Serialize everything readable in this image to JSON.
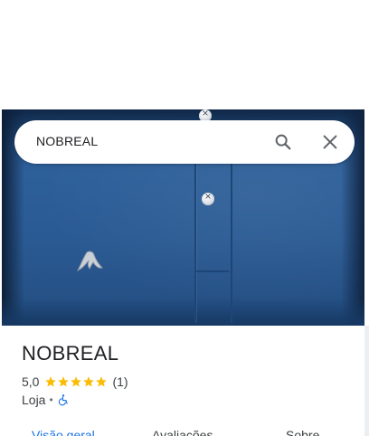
{
  "search": {
    "query": "NOBREAL"
  },
  "place": {
    "name": "NOBREAL",
    "rating": "5,0",
    "stars": 5,
    "review_count": "(1)",
    "category": "Loja",
    "separator": "•"
  },
  "tabs": [
    {
      "label": "Visão geral",
      "active": true
    },
    {
      "label": "Avaliações",
      "active": false
    },
    {
      "label": "Sobre",
      "active": false
    }
  ],
  "colors": {
    "accent": "#1a73e8",
    "star": "#fbbc04",
    "text_primary": "#202124",
    "text_secondary": "#3c4043"
  },
  "icons": {
    "search": "search-icon",
    "close": "close-icon",
    "accessibility": "wheelchair-icon"
  }
}
